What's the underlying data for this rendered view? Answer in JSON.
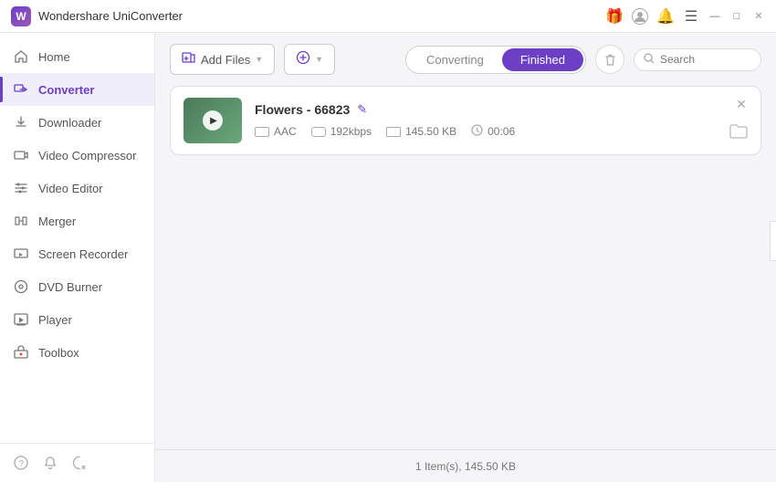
{
  "app": {
    "title": "Wondershare UniConverter",
    "logo": "W"
  },
  "titlebar": {
    "icons": {
      "gift": "🎁",
      "user": "👤",
      "bell": "🔔",
      "menu": "☰",
      "minimize": "—",
      "maximize": "□",
      "close": "✕"
    }
  },
  "sidebar": {
    "items": [
      {
        "id": "home",
        "label": "Home",
        "icon": "⌂",
        "active": false
      },
      {
        "id": "converter",
        "label": "Converter",
        "icon": "⟳",
        "active": true
      },
      {
        "id": "downloader",
        "label": "Downloader",
        "icon": "↓",
        "active": false
      },
      {
        "id": "video-compressor",
        "label": "Video Compressor",
        "icon": "⊟",
        "active": false
      },
      {
        "id": "video-editor",
        "label": "Video Editor",
        "icon": "✂",
        "active": false
      },
      {
        "id": "merger",
        "label": "Merger",
        "icon": "⊕",
        "active": false
      },
      {
        "id": "screen-recorder",
        "label": "Screen Recorder",
        "icon": "▶",
        "active": false
      },
      {
        "id": "dvd-burner",
        "label": "DVD Burner",
        "icon": "◎",
        "active": false
      },
      {
        "id": "player",
        "label": "Player",
        "icon": "▷",
        "active": false
      },
      {
        "id": "toolbox",
        "label": "Toolbox",
        "icon": "⚙",
        "active": false
      }
    ],
    "bottom_icons": {
      "help": "?",
      "notifications": "🔔",
      "feedback": "↻"
    }
  },
  "toolbar": {
    "add_file_label": "Add Files",
    "add_btn_label": "Add",
    "tabs": {
      "converting": "Converting",
      "finished": "Finished",
      "active": "finished"
    },
    "search_placeholder": "Search"
  },
  "file_card": {
    "name": "Flowers - 66823",
    "format": "AAC",
    "bitrate": "192kbps",
    "size": "145.50 KB",
    "duration": "00:06"
  },
  "status_bar": {
    "text": "1 Item(s), 145.50 KB"
  }
}
